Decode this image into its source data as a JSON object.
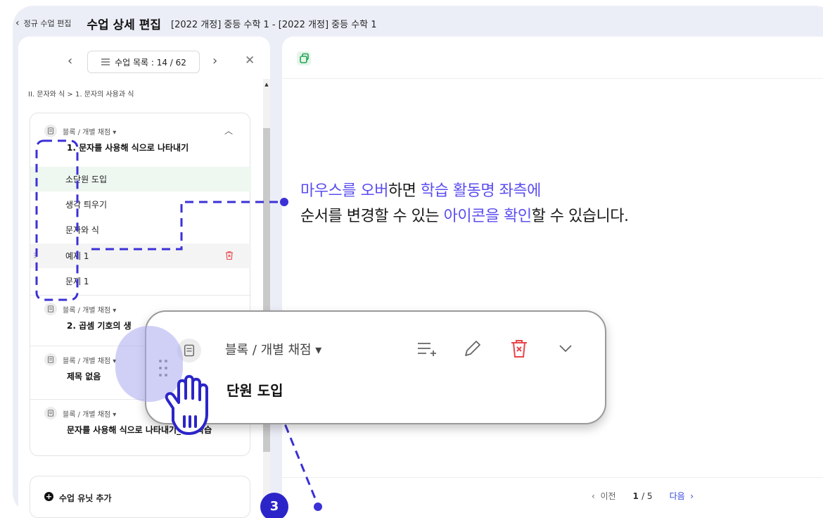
{
  "header": {
    "back_label": "정규 수업 편집",
    "page_title": "수업 상세 편집",
    "course_title": "[2022 개정] 중등 수학 1 - [2022 개정] 중등 수학 1"
  },
  "left_panel": {
    "lesson_list_label": "수업 목록 : 14 / 62",
    "breadcrumb": "II. 문자와 식 > 1. 문자의 사용과 식",
    "units": [
      {
        "meta": "블록 / 개별 채점 ▾",
        "title": "1. 문자를 사용해 식으로 나타내기",
        "activities": [
          "소단원 도입",
          "생각 틔우기",
          "문자와 식",
          "예제 1",
          "문제 1"
        ]
      },
      {
        "meta": "블록 / 개별 채점 ▾",
        "title": "2. 곱셈 기호의 생"
      },
      {
        "meta": "블록 / 개별 채점 ▾",
        "title": "제목 없음"
      },
      {
        "meta": "블록 / 개별 채점 ▾",
        "title": "문자를 사용해 식으로 나타내기_보충학습"
      }
    ],
    "add_unit_label": "수업 유닛 추가"
  },
  "pager": {
    "prev_label": "이전",
    "current": "1",
    "total": "/ 5",
    "next_label": "다음"
  },
  "callout": {
    "line1_a": "마우스를 오버",
    "line1_b": "하면 ",
    "line1_c": "학습 활동명 좌측에",
    "line2_a": "순서를 변경할 수 있는 ",
    "line2_b": "아이콘을 확인",
    "line2_c": "할 수 있습니다."
  },
  "zoom": {
    "meta": "블록 / 개별 채점 ▾",
    "title": "단원 도입"
  },
  "step_badge": "3",
  "colors": {
    "accent": "#5b4ef0",
    "badge": "#2b25c9",
    "delete": "#e8454a",
    "selected_bg": "#eef7f0"
  }
}
